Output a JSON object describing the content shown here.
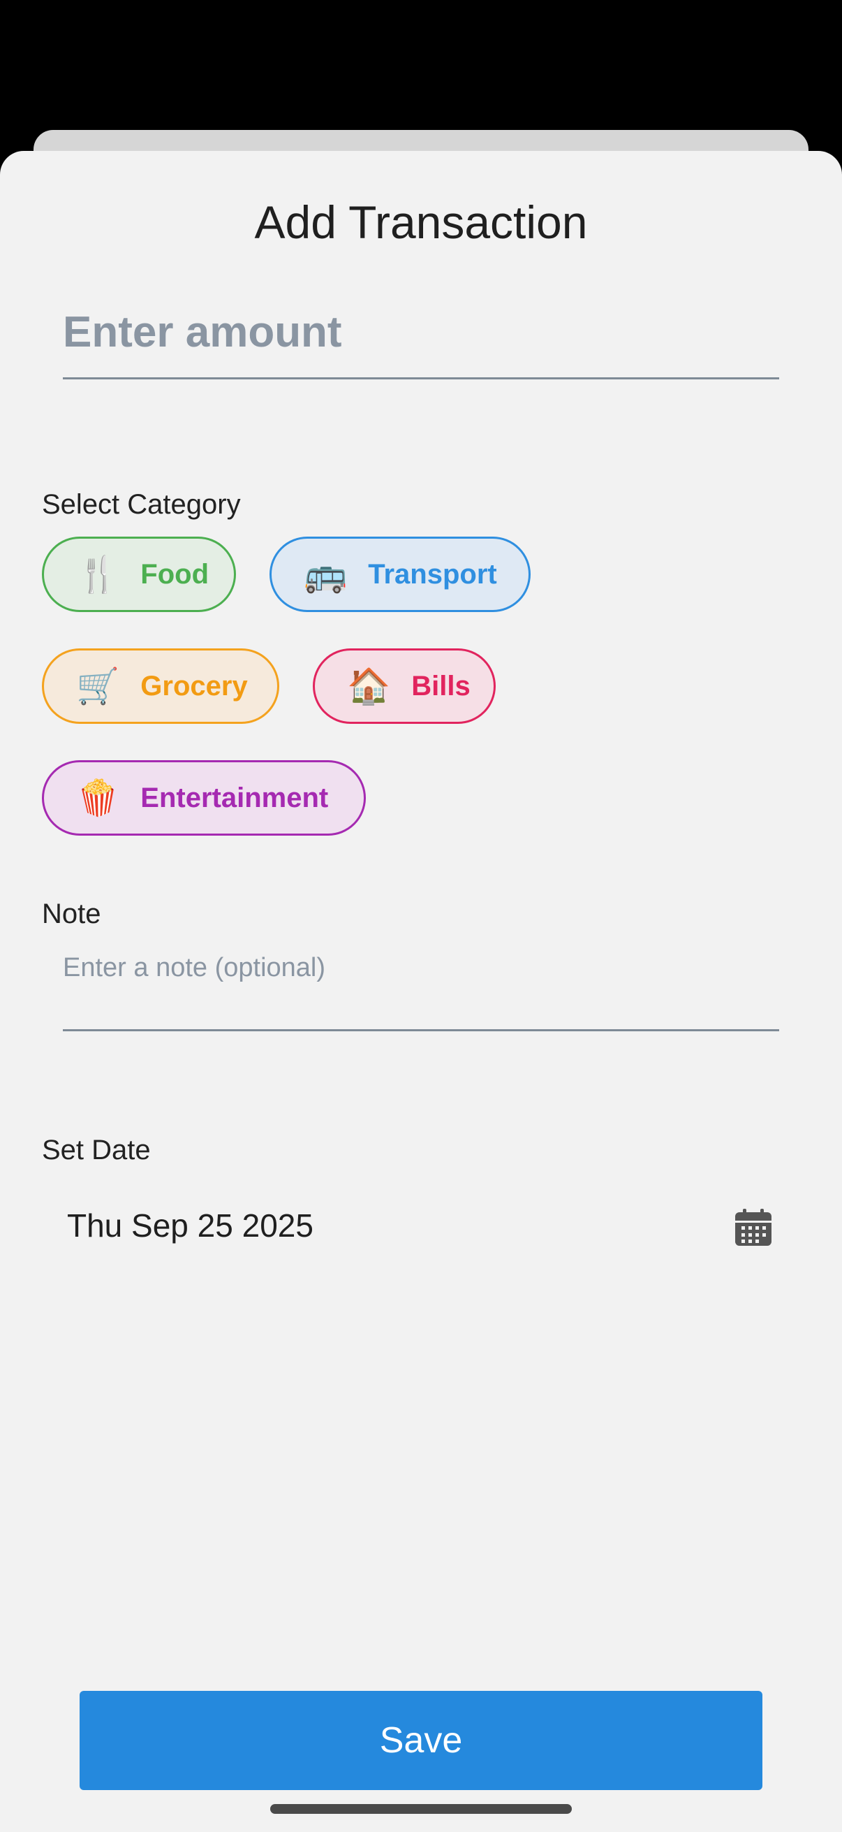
{
  "sheet": {
    "title": "Add Transaction"
  },
  "amount": {
    "placeholder": "Enter amount",
    "value": ""
  },
  "category": {
    "label": "Select Category",
    "items": [
      {
        "label": "Food",
        "emoji": "🍴",
        "color": "#4caf50"
      },
      {
        "label": "Transport",
        "emoji": "🚌",
        "color": "#2f8fe0"
      },
      {
        "label": "Grocery",
        "emoji": "🛒",
        "color": "#f29b13"
      },
      {
        "label": "Bills",
        "emoji": "🏠",
        "color": "#e1245e"
      },
      {
        "label": "Entertainment",
        "emoji": "🍿",
        "color": "#a52ab1"
      }
    ]
  },
  "note": {
    "label": "Note",
    "placeholder": "Enter a note (optional)",
    "value": ""
  },
  "date": {
    "label": "Set Date",
    "value": "Thu Sep 25 2025",
    "icon": "calendar-icon"
  },
  "actions": {
    "save_label": "Save"
  },
  "colors": {
    "accent": "#2589dd",
    "sheet_background": "#f2f2f2"
  }
}
